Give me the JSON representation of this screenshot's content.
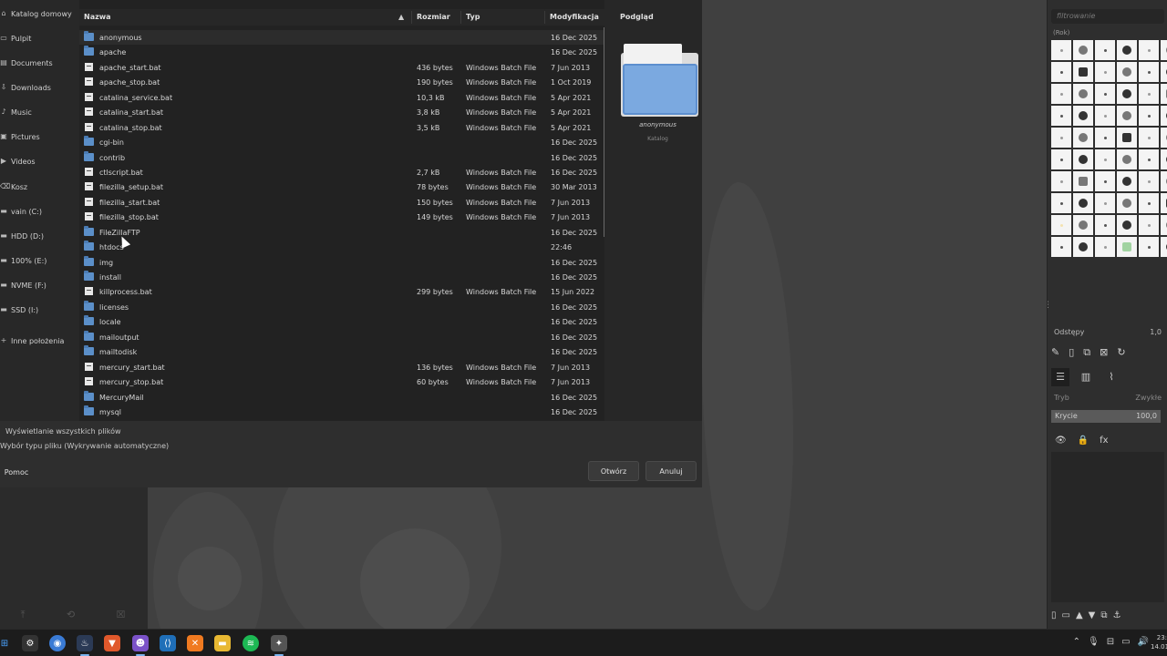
{
  "dialog": {
    "places": [
      {
        "label": "Katalog domowy",
        "icon": "home-icon"
      },
      {
        "label": "Pulpit",
        "icon": "desktop-icon"
      },
      {
        "label": "Documents",
        "icon": "document-icon"
      },
      {
        "label": "Downloads",
        "icon": "download-icon"
      },
      {
        "label": "Music",
        "icon": "music-icon"
      },
      {
        "label": "Pictures",
        "icon": "picture-icon"
      },
      {
        "label": "Videos",
        "icon": "video-icon"
      },
      {
        "label": "Kosz",
        "icon": "trash-icon"
      },
      {
        "label": "vain (C:)",
        "icon": "drive-icon"
      },
      {
        "label": "HDD (D:)",
        "icon": "drive-icon"
      },
      {
        "label": "100% (E:)",
        "icon": "drive-icon"
      },
      {
        "label": "NVME (F:)",
        "icon": "drive-icon"
      },
      {
        "label": "SSD (I:)",
        "icon": "drive-icon"
      },
      {
        "label": "Inne położenia",
        "icon": "plus-icon"
      }
    ],
    "columns": {
      "name": "Nazwa",
      "size": "Rozmiar",
      "type": "Typ",
      "modified": "Modyfikacja",
      "preview": "Podgląd"
    },
    "files": [
      {
        "name": "anonymous",
        "kind": "folder",
        "size": "",
        "type": "",
        "modified": "16 Dec 2025"
      },
      {
        "name": "apache",
        "kind": "folder",
        "size": "",
        "type": "",
        "modified": "16 Dec 2025"
      },
      {
        "name": "apache_start.bat",
        "kind": "file",
        "size": "436 bytes",
        "type": "Windows Batch File",
        "modified": "7 Jun 2013"
      },
      {
        "name": "apache_stop.bat",
        "kind": "file",
        "size": "190 bytes",
        "type": "Windows Batch File",
        "modified": "1 Oct 2019"
      },
      {
        "name": "catalina_service.bat",
        "kind": "file",
        "size": "10,3 kB",
        "type": "Windows Batch File",
        "modified": "5 Apr 2021"
      },
      {
        "name": "catalina_start.bat",
        "kind": "file",
        "size": "3,8 kB",
        "type": "Windows Batch File",
        "modified": "5 Apr 2021"
      },
      {
        "name": "catalina_stop.bat",
        "kind": "file",
        "size": "3,5 kB",
        "type": "Windows Batch File",
        "modified": "5 Apr 2021"
      },
      {
        "name": "cgi-bin",
        "kind": "folder",
        "size": "",
        "type": "",
        "modified": "16 Dec 2025"
      },
      {
        "name": "contrib",
        "kind": "folder",
        "size": "",
        "type": "",
        "modified": "16 Dec 2025"
      },
      {
        "name": "ctlscript.bat",
        "kind": "file",
        "size": "2,7 kB",
        "type": "Windows Batch File",
        "modified": "16 Dec 2025"
      },
      {
        "name": "filezilla_setup.bat",
        "kind": "file",
        "size": "78 bytes",
        "type": "Windows Batch File",
        "modified": "30 Mar 2013"
      },
      {
        "name": "filezilla_start.bat",
        "kind": "file",
        "size": "150 bytes",
        "type": "Windows Batch File",
        "modified": "7 Jun 2013"
      },
      {
        "name": "filezilla_stop.bat",
        "kind": "file",
        "size": "149 bytes",
        "type": "Windows Batch File",
        "modified": "7 Jun 2013"
      },
      {
        "name": "FileZillaFTP",
        "kind": "folder",
        "size": "",
        "type": "",
        "modified": "16 Dec 2025"
      },
      {
        "name": "htdocs",
        "kind": "folder",
        "size": "",
        "type": "",
        "modified": "22:46"
      },
      {
        "name": "img",
        "kind": "folder",
        "size": "",
        "type": "",
        "modified": "16 Dec 2025"
      },
      {
        "name": "install",
        "kind": "folder",
        "size": "",
        "type": "",
        "modified": "16 Dec 2025"
      },
      {
        "name": "killprocess.bat",
        "kind": "file",
        "size": "299 bytes",
        "type": "Windows Batch File",
        "modified": "15 Jun 2022"
      },
      {
        "name": "licenses",
        "kind": "folder",
        "size": "",
        "type": "",
        "modified": "16 Dec 2025"
      },
      {
        "name": "locale",
        "kind": "folder",
        "size": "",
        "type": "",
        "modified": "16 Dec 2025"
      },
      {
        "name": "mailoutput",
        "kind": "folder",
        "size": "",
        "type": "",
        "modified": "16 Dec 2025"
      },
      {
        "name": "mailtodisk",
        "kind": "folder",
        "size": "",
        "type": "",
        "modified": "16 Dec 2025"
      },
      {
        "name": "mercury_start.bat",
        "kind": "file",
        "size": "136 bytes",
        "type": "Windows Batch File",
        "modified": "7 Jun 2013"
      },
      {
        "name": "mercury_stop.bat",
        "kind": "file",
        "size": "60 bytes",
        "type": "Windows Batch File",
        "modified": "7 Jun 2013"
      },
      {
        "name": "MercuryMail",
        "kind": "folder",
        "size": "",
        "type": "",
        "modified": "16 Dec 2025"
      },
      {
        "name": "mysql",
        "kind": "folder",
        "size": "",
        "type": "",
        "modified": "16 Dec 2025"
      }
    ],
    "preview": {
      "name": "anonymous",
      "kind": "Katalog"
    },
    "show_all": "Wyświetlanie wszystkich plików",
    "file_type": "Wybór typu pliku (Wykrywanie automatyczne)",
    "buttons": {
      "help": "Pomoc",
      "open": "Otwórz",
      "cancel": "Anuluj"
    }
  },
  "dock": {
    "filter_placeholder": "filtrowanie",
    "brush_tag": "(Rok)",
    "spacing_label": "Odstępy",
    "spacing_value": "1,0",
    "mode_label": "Tryb",
    "mode_value": "Zwykłe",
    "opacity_label": "Krycie",
    "opacity_value": "100,0"
  },
  "colors": {
    "folder": "#5b8fc9",
    "dialog_bg": "#2b2b2b",
    "list_bg": "#222222",
    "taskbar": "#1c1c1c"
  },
  "taskbar": {
    "clock_time": "23:",
    "clock_date": "14.01.20"
  }
}
